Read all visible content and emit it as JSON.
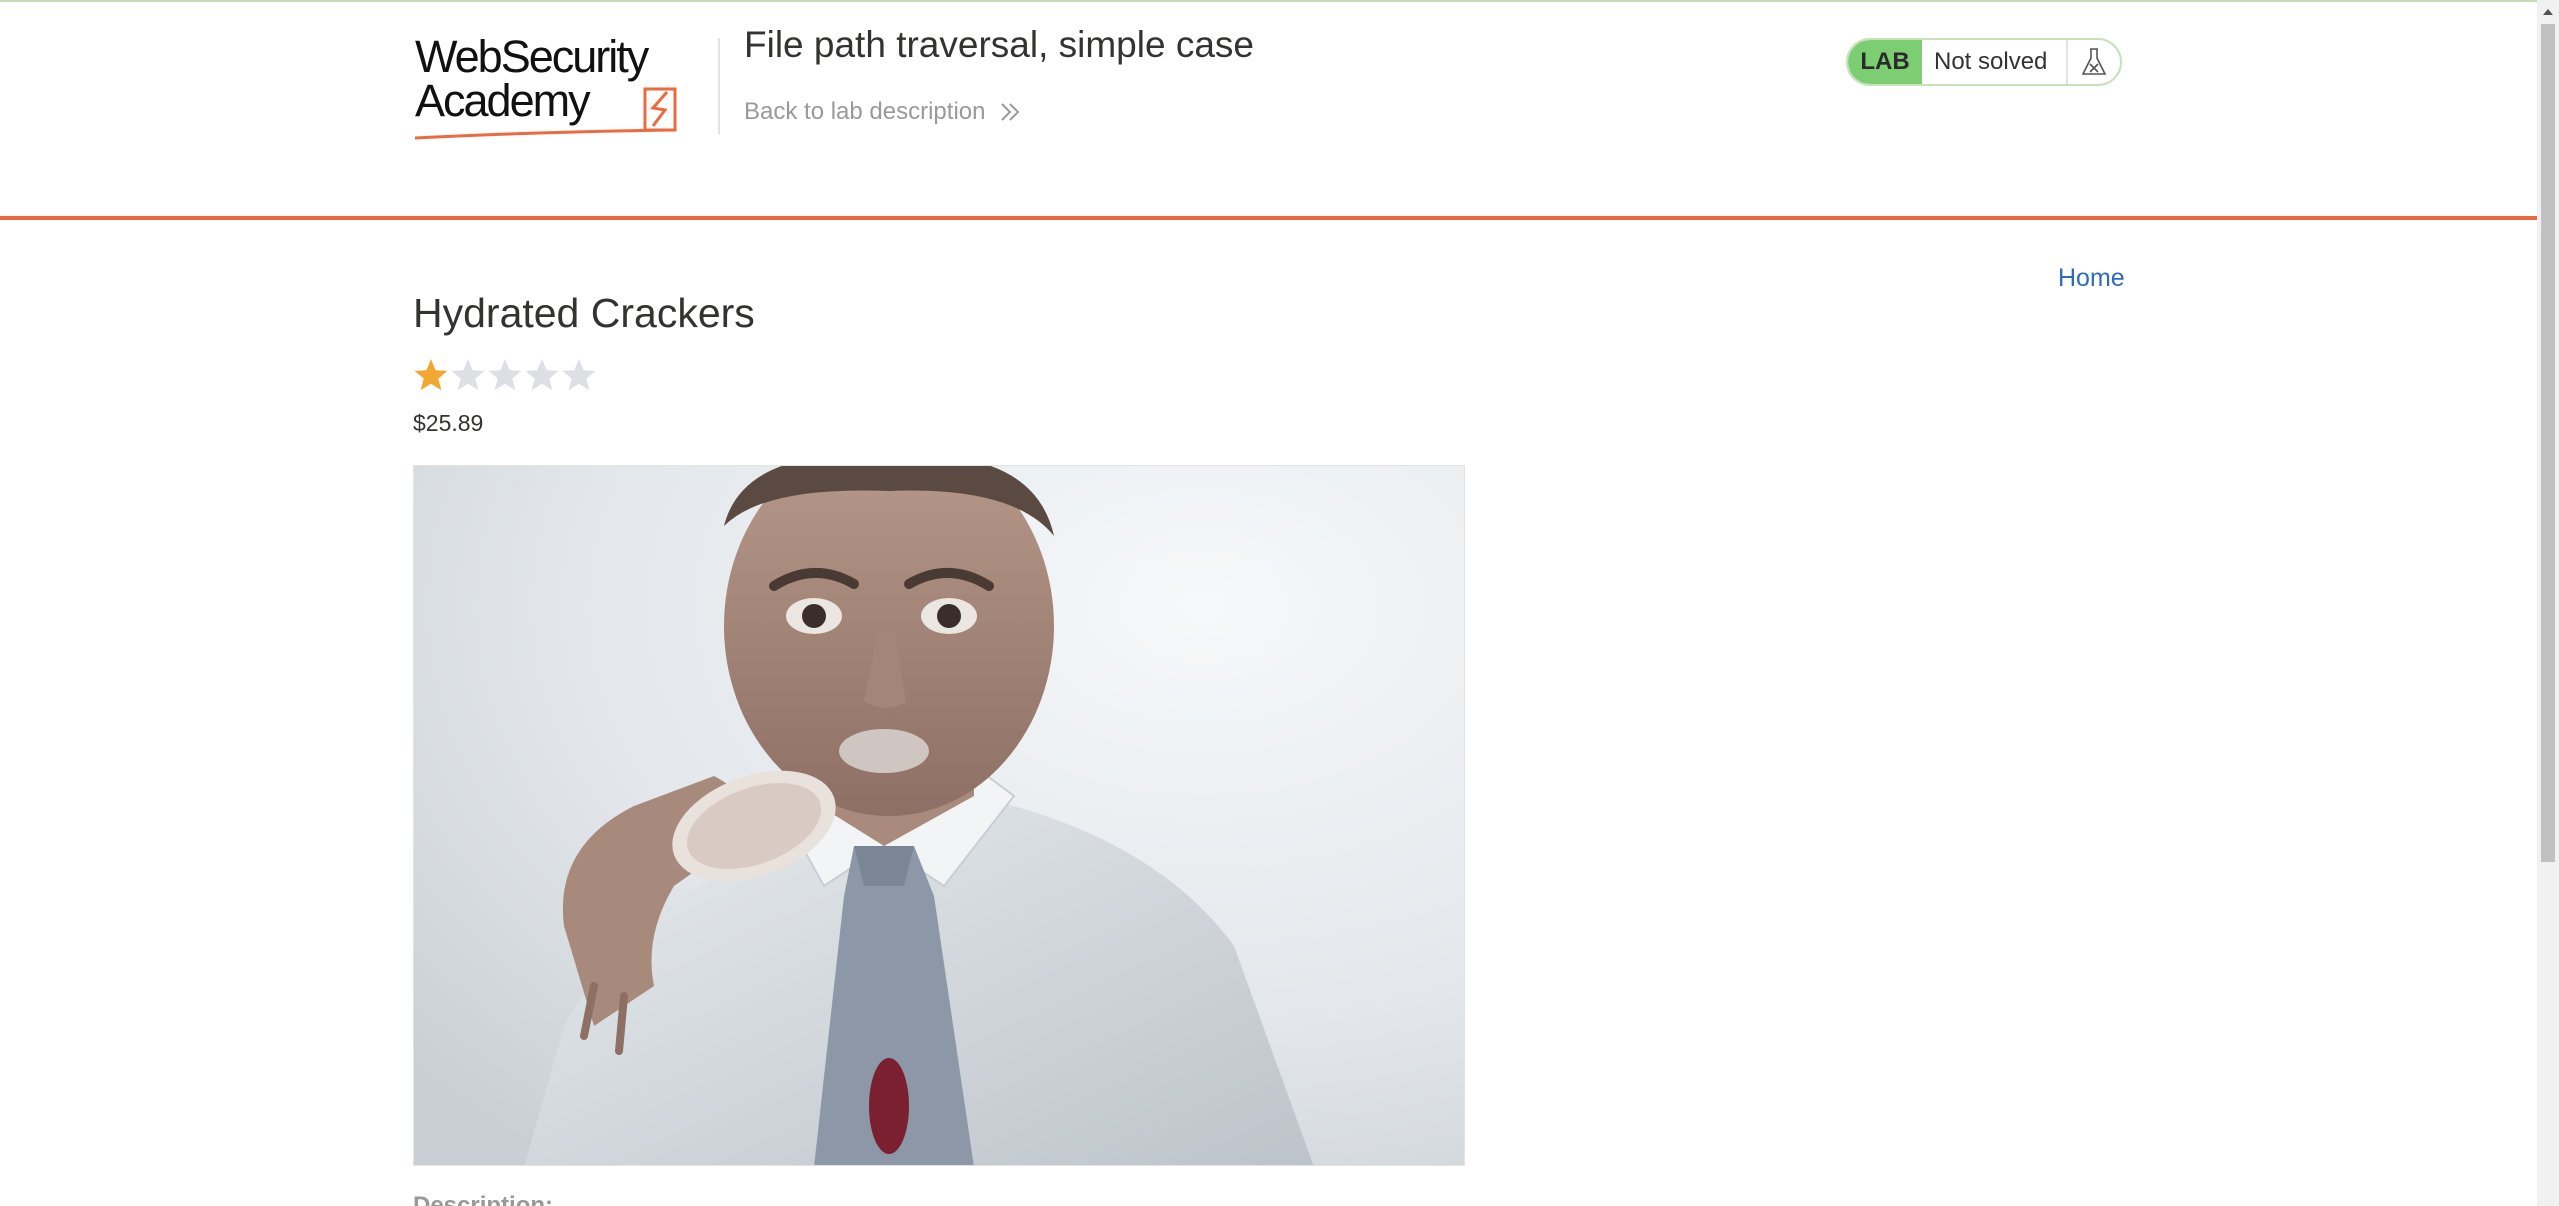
{
  "header": {
    "logo_line1": "WebSecurity",
    "logo_line2": "Academy",
    "lab_title": "File path traversal, simple case",
    "back_link_label": "Back to lab description"
  },
  "lab_status": {
    "badge": "LAB",
    "state": "Not solved",
    "flask_icon": "flask-icon"
  },
  "nav": {
    "home_label": "Home"
  },
  "product": {
    "title": "Hydrated Crackers",
    "rating": 1,
    "rating_max": 5,
    "price": "$25.89",
    "image_alt": "Man in white shirt and tie eating a sugary doughnut",
    "description_label": "Description:"
  },
  "colors": {
    "accent_orange": "#ec6a3e",
    "lab_green": "#7dce72",
    "link_blue": "#2e6bb8",
    "star_filled": "#f0a832",
    "star_empty": "#dcdfe3"
  }
}
